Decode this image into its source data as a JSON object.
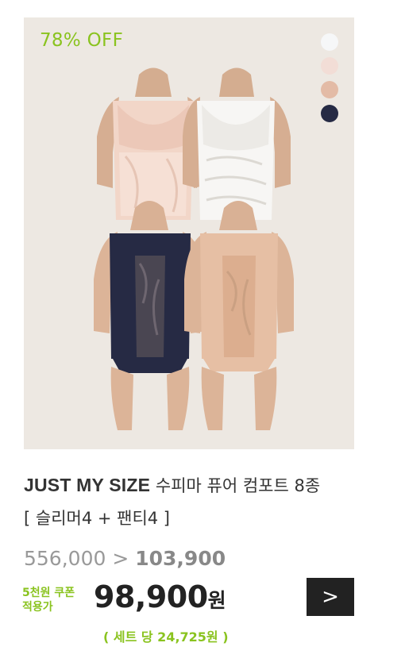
{
  "product": {
    "discount_label": "78% OFF",
    "swatches": [
      "#f6f7f8",
      "#f2ddd6",
      "#e3bba6",
      "#262a44"
    ],
    "brand": "JUST MY SIZE",
    "name": "수피마 퓨어 컴포트 8종",
    "subtitle": "[ 슬리머4 + 팬티4 ]",
    "original_price": "556,000",
    "price_separator": ">",
    "sale_price": "103,900",
    "coupon_line1": "5천원 쿠폰",
    "coupon_line2": "적용가",
    "final_price": "98,900",
    "final_unit": "원",
    "per_set": "( 세트 당 24,725원 )",
    "go_label": ">"
  }
}
